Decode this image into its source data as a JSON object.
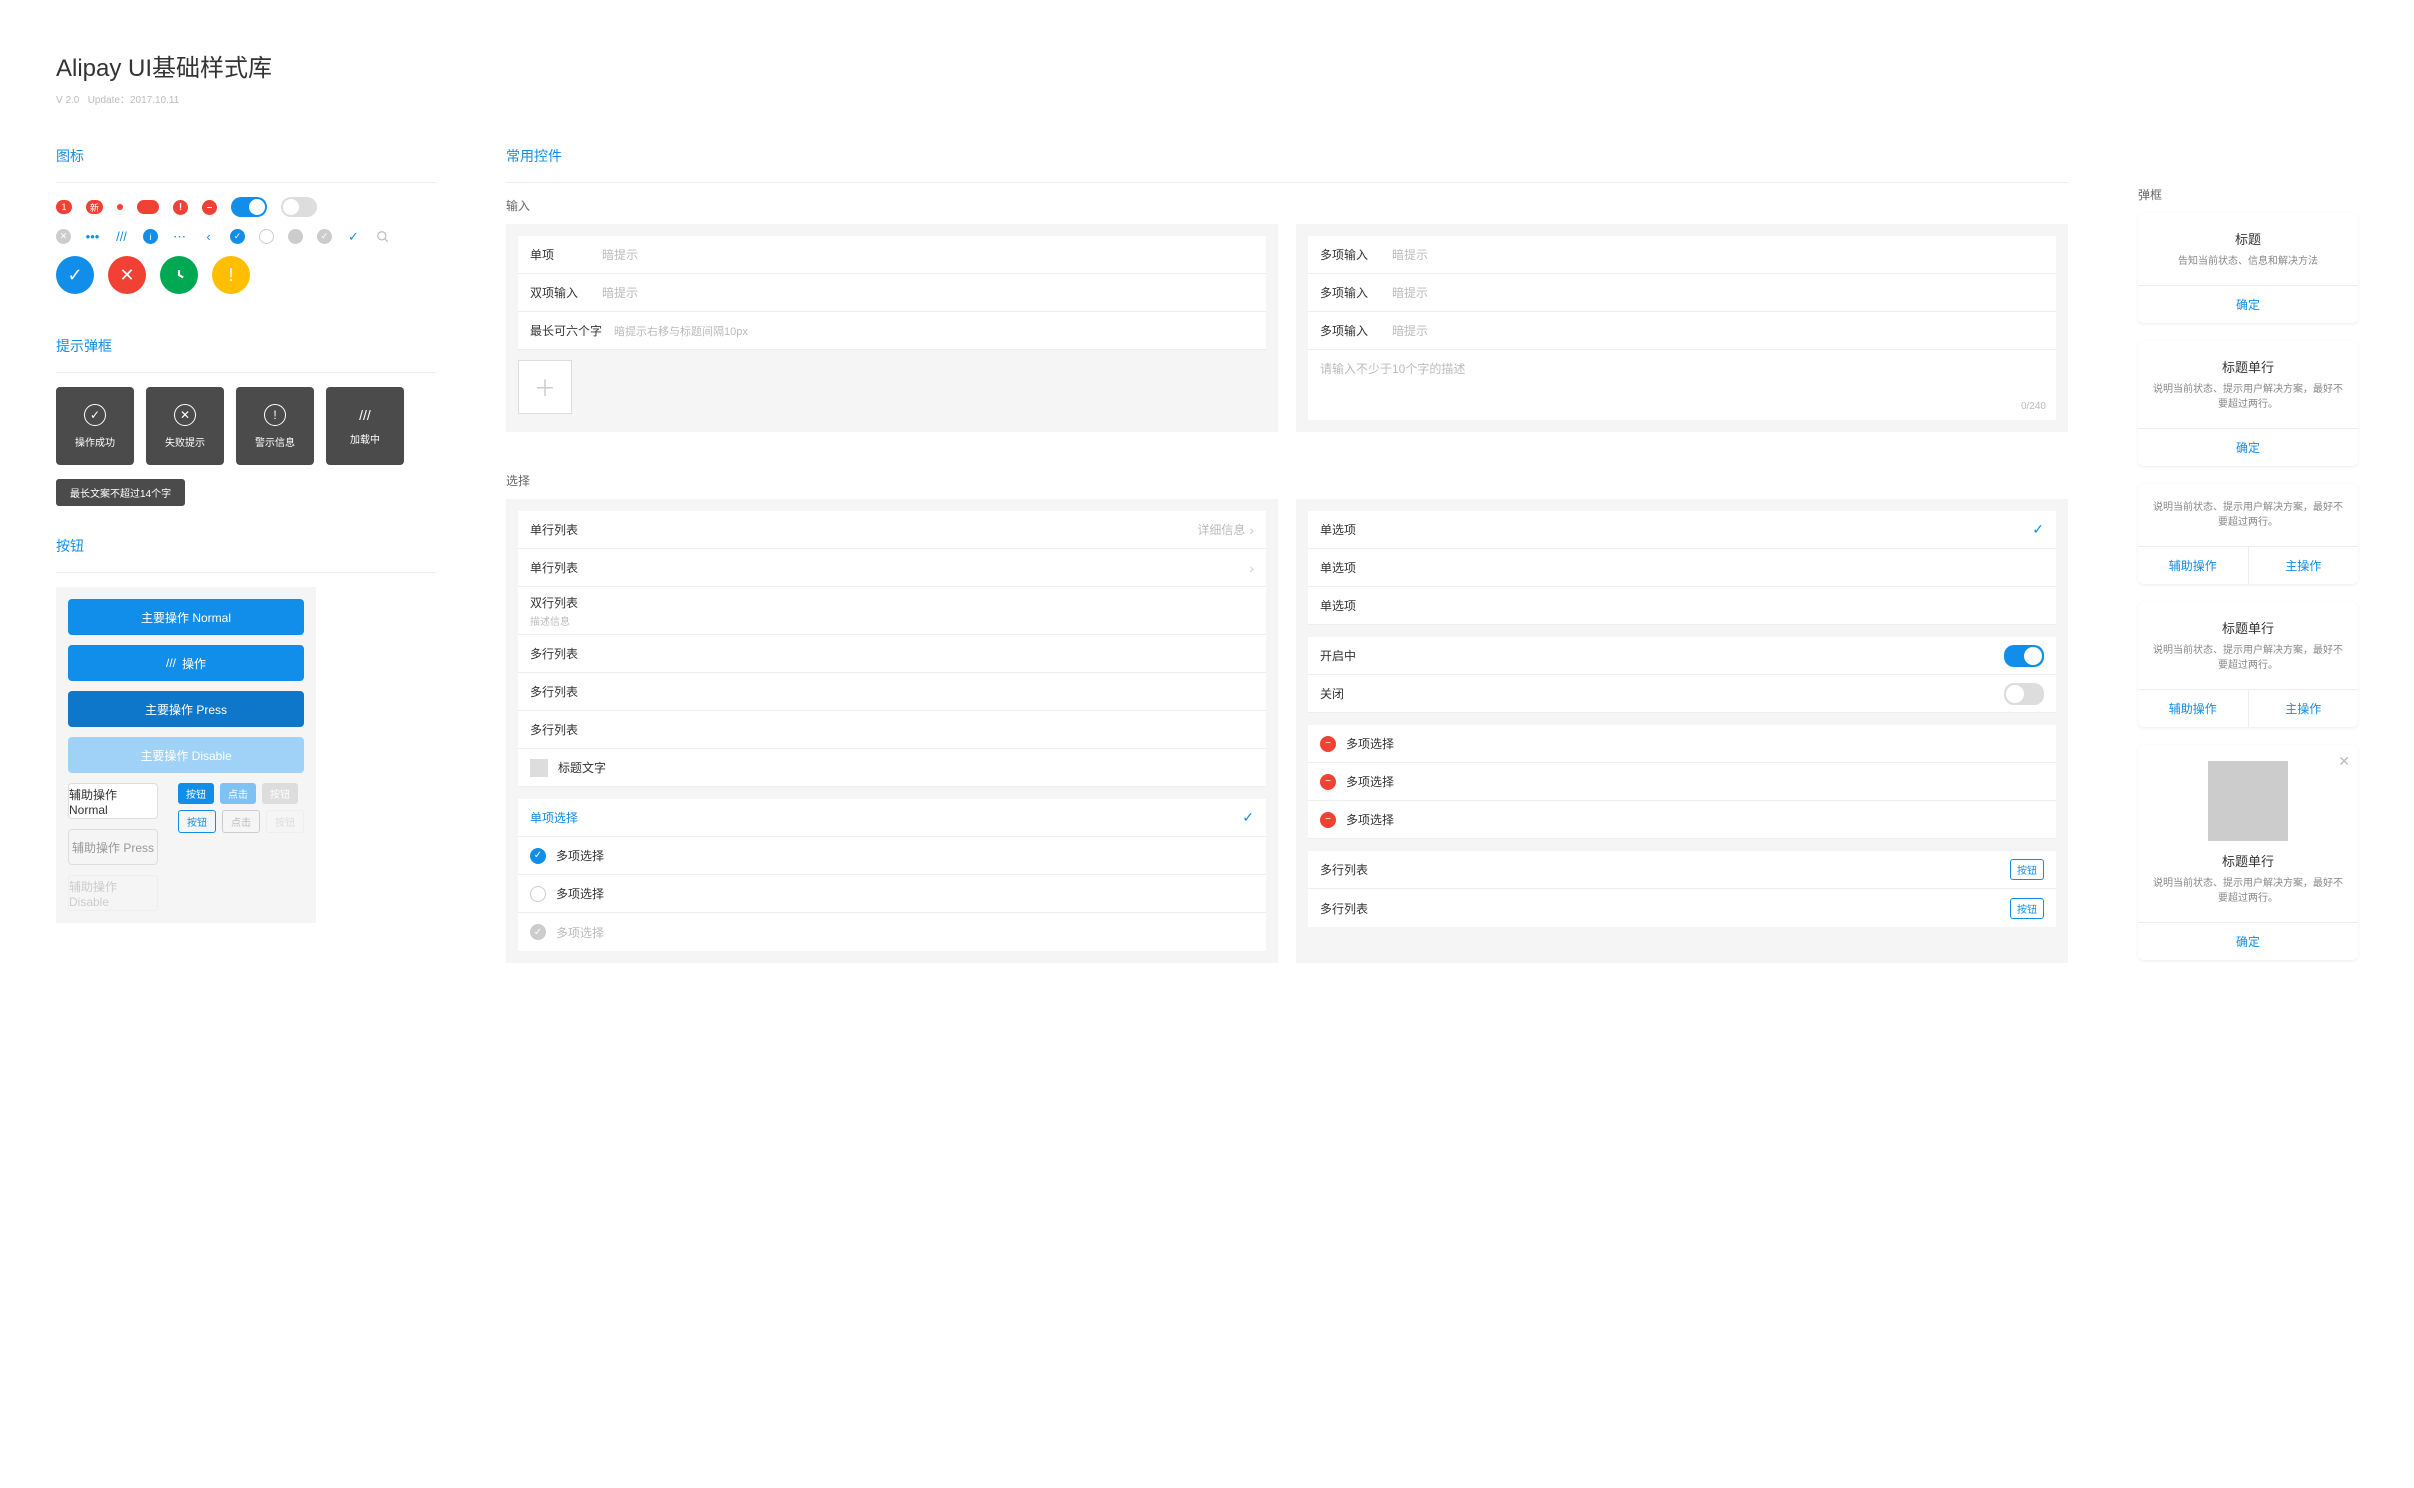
{
  "header": {
    "title": "Alipay UI基础样式库",
    "version": "V 2.0",
    "update": "Update：2017.10.11"
  },
  "sections": {
    "icons": "图标",
    "toast": "提示弹框",
    "buttons": "按钮",
    "controls": "常用控件",
    "input": "输入",
    "select": "选择",
    "dialog": "弹框"
  },
  "badges": {
    "b1": "1",
    "b2": "新",
    "b3": "…",
    "exc": "!",
    "minus": "–"
  },
  "toasts": {
    "success": "操作成功",
    "fail": "失败提示",
    "warn": "警示信息",
    "loading": "加载中",
    "longtext": "最长文案不超过14个字"
  },
  "btns": {
    "primary_normal": "主要操作 Normal",
    "primary_loading": "操作",
    "primary_press": "主要操作 Press",
    "primary_disable": "主要操作 Disable",
    "secondary_normal": "辅助操作 Normal",
    "secondary_press": "辅助操作 Press",
    "secondary_disable": "辅助操作 Disable",
    "tag_btn": "按钮",
    "tag_tap": "点击"
  },
  "inputs": {
    "single": {
      "label": "单项",
      "ph": "暗提示"
    },
    "double": {
      "label": "双项输入",
      "ph": "暗提示"
    },
    "maxsix": {
      "label": "最长可六个字",
      "ph": "暗提示右移与标题间隔10px"
    },
    "multi": {
      "label": "多项输入",
      "ph": "暗提示"
    },
    "textarea_ph": "请输入不少于10个字的描述",
    "counter": "0/240"
  },
  "lists": {
    "single_row": "单行列表",
    "detail": "详细信息",
    "double_row": "双行列表",
    "desc_info": "描述信息",
    "multi_row": "多行列表",
    "title_text": "标题文字",
    "single_select": "单项选择",
    "multi_select": "多项选择",
    "radio": "单选项",
    "toggle_on": "开启中",
    "toggle_off": "关闭",
    "tag_btn": "按钮"
  },
  "dialogs": {
    "d1": {
      "title": "标题",
      "desc": "告知当前状态、信息和解决方法",
      "ok": "确定"
    },
    "d2": {
      "title": "标题单行",
      "desc": "说明当前状态、提示用户解决方案，最好不要超过两行。",
      "ok": "确定"
    },
    "d3": {
      "desc": "说明当前状态、提示用户解决方案，最好不要超过两行。",
      "secondary": "辅助操作",
      "primary": "主操作"
    },
    "d4": {
      "title": "标题单行",
      "desc": "说明当前状态、提示用户解决方案，最好不要超过两行。",
      "secondary": "辅助操作",
      "primary": "主操作"
    },
    "d5": {
      "title": "标题单行",
      "desc": "说明当前状态、提示用户解决方案，最好不要超过两行。",
      "ok": "确定"
    }
  }
}
